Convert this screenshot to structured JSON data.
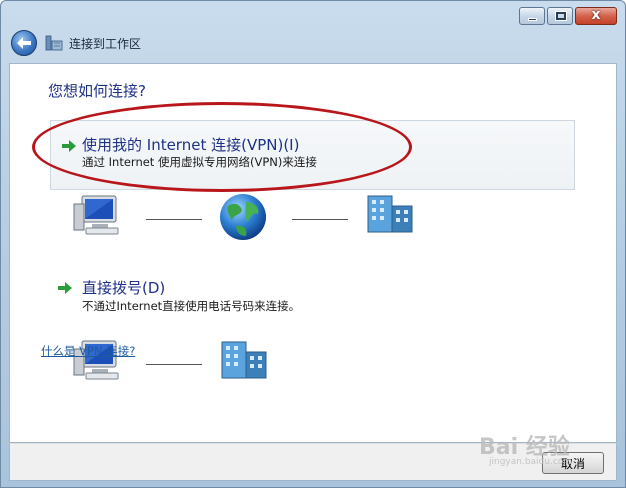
{
  "window": {
    "title": "连接到工作区"
  },
  "caption": {
    "minimize": "",
    "maximize": "",
    "close": "x"
  },
  "main": {
    "question": "您想如何连接?",
    "options": [
      {
        "title": "使用我的 Internet 连接(VPN)(I)",
        "description": "通过 Internet 使用虚拟专用网络(VPN)来连接"
      },
      {
        "title": "直接拨号(D)",
        "description": "不通过Internet直接使用电话号码来连接。"
      }
    ],
    "help_link": "什么是 VPN 连接?"
  },
  "footer": {
    "cancel_label": "取消"
  },
  "watermark": {
    "text": "Bai 经验",
    "sub": "jingyan.baidu.com"
  },
  "icons": {
    "back": "back-arrow-icon",
    "window": "network-icon",
    "option_arrow": "green-arrow-icon",
    "computer": "computer-icon",
    "globe": "globe-icon",
    "building": "office-building-icon"
  },
  "colors": {
    "heading": "#1e3287",
    "highlight_circle": "#b8161b",
    "link": "#1e5aa0"
  }
}
